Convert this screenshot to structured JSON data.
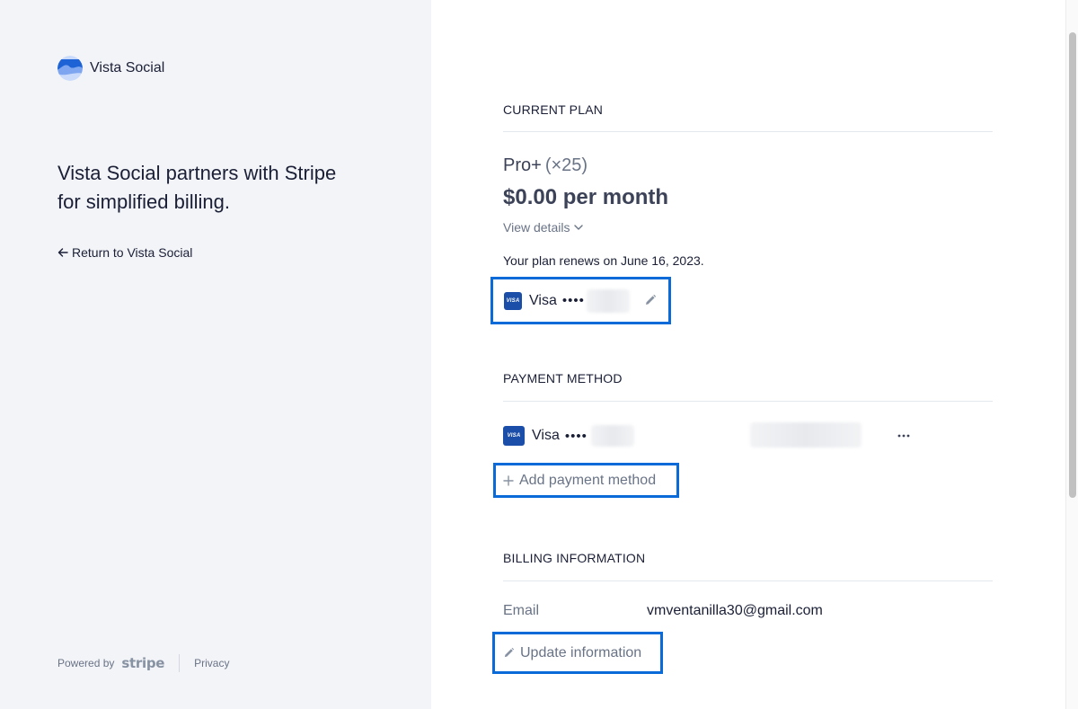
{
  "brand": {
    "name": "Vista Social",
    "tagline": "Vista Social partners with Stripe for simplified billing.",
    "return_link": "Return to Vista Social"
  },
  "footer": {
    "powered_by": "Powered by",
    "stripe": "stripe",
    "privacy": "Privacy"
  },
  "current_plan": {
    "title": "CURRENT PLAN",
    "plan_name": "Pro+",
    "plan_quantity": "(×25)",
    "price": "$0.00 per month",
    "view_details": "View details",
    "renews": "Your plan renews on June 16, 2023.",
    "card_label": "Visa",
    "card_mask": "••••"
  },
  "payment_method": {
    "title": "PAYMENT METHOD",
    "card_label": "Visa",
    "card_mask": "••••",
    "add_label": "Add payment method"
  },
  "billing_information": {
    "title": "BILLING INFORMATION",
    "email_label": "Email",
    "email_value": "vmventanilla30@gmail.com",
    "update_label": "Update information"
  },
  "icons": {
    "brand_logo": "vista-social-logo",
    "card_brand": "visa-card-icon",
    "edit": "pencil-icon",
    "more": "ellipsis-icon",
    "add": "plus-icon",
    "dropdown": "chevron-down-icon",
    "back": "arrow-left-icon"
  },
  "colors": {
    "highlight": "#0a6ad8",
    "visa_blue": "#1a4ea8",
    "left_panel_bg": "#f3f4f8",
    "muted_text": "#697386"
  },
  "card_chip_text": "VISA"
}
